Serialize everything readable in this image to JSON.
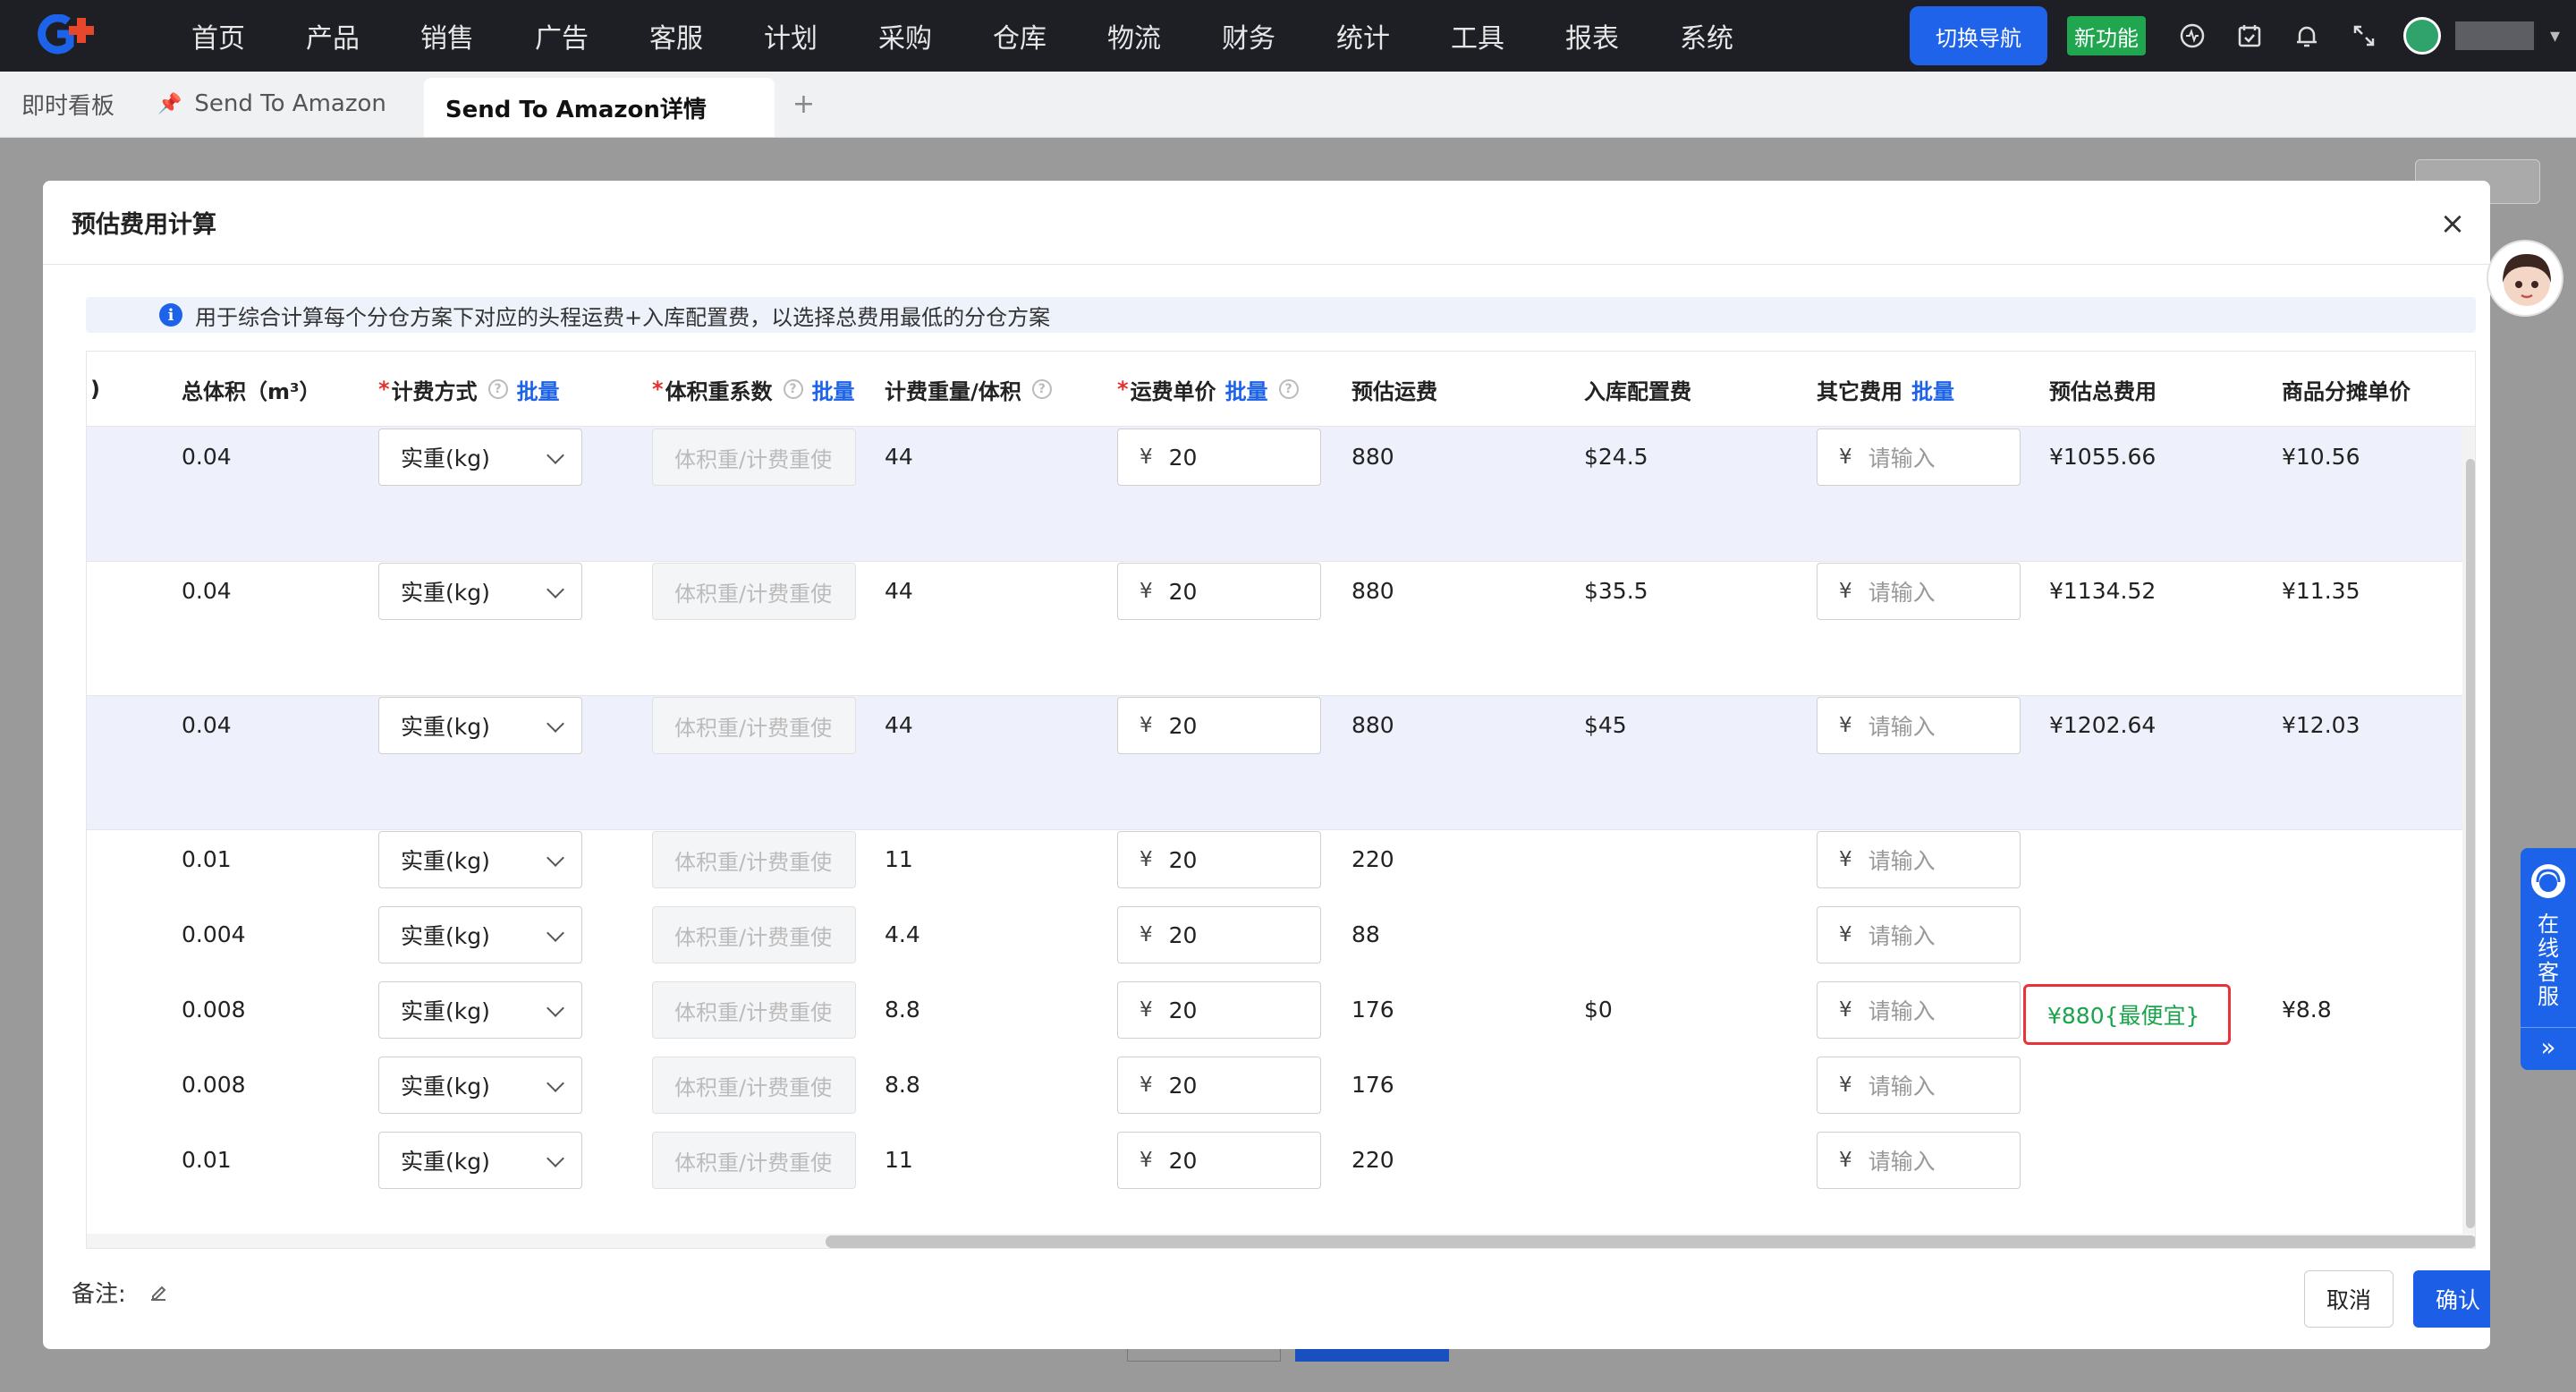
{
  "nav": {
    "items": [
      "首页",
      "产品",
      "销售",
      "广告",
      "客服",
      "计划",
      "采购",
      "仓库",
      "物流",
      "财务",
      "统计",
      "工具",
      "报表",
      "系统"
    ],
    "switch_nav": "切换导航",
    "new_feature": "新功能"
  },
  "tabs": {
    "items": [
      "即时看板",
      "Send To Amazon",
      "Send To Amazon详情"
    ],
    "plus": "+"
  },
  "modal": {
    "title": "预估费用计算",
    "close": "×",
    "info_text": "用于综合计算每个分仓方案下对应的头程运费+入库配置费，以选择总费用最低的分仓方案",
    "remark_label": "备注:",
    "cancel": "取消",
    "confirm": "确认"
  },
  "table": {
    "columns": {
      "paren": ")",
      "total_volume": "总体积（m³）",
      "billing_method": "计费方式",
      "volume_factor": "体积重系数",
      "billing_weight": "计费重量/体积",
      "freight_unit_price": "运费单价",
      "est_freight": "预估运费",
      "inbound_fee": "入库配置费",
      "other_fee": "其它费用",
      "est_total": "预估总费用",
      "unit_price": "商品分摊单价",
      "batch": "批量",
      "required": "*"
    },
    "select_value": "实重(kg)",
    "volume_placeholder": "体积重/计费重使",
    "yen": "¥",
    "other_placeholder": "请输入",
    "rows": [
      {
        "volume": "0.04",
        "weight": "44",
        "price": "20",
        "freight": "880",
        "inbound": "$24.5",
        "total": "¥1055.66",
        "unit": "¥10.56"
      },
      {
        "volume": "0.04",
        "weight": "44",
        "price": "20",
        "freight": "880",
        "inbound": "$35.5",
        "total": "¥1134.52",
        "unit": "¥11.35"
      },
      {
        "volume": "0.04",
        "weight": "44",
        "price": "20",
        "freight": "880",
        "inbound": "$45",
        "total": "¥1202.64",
        "unit": "¥12.03"
      }
    ],
    "group": {
      "rows": [
        {
          "volume": "0.01",
          "weight": "11",
          "price": "20",
          "freight": "220"
        },
        {
          "volume": "0.004",
          "weight": "4.4",
          "price": "20",
          "freight": "88"
        },
        {
          "volume": "0.008",
          "weight": "8.8",
          "price": "20",
          "freight": "176"
        },
        {
          "volume": "0.008",
          "weight": "8.8",
          "price": "20",
          "freight": "176"
        },
        {
          "volume": "0.01",
          "weight": "11",
          "price": "20",
          "freight": "220"
        }
      ],
      "inbound": "$0",
      "total": "¥880{最便宜}",
      "unit": "¥8.8"
    }
  },
  "customer_service": {
    "label": "在线客服",
    "collapse": "»"
  },
  "colors": {
    "accent": "#1d63e9",
    "highlight_row": "#eef1fb",
    "cheapest_border": "#e8333a",
    "cheapest_text": "#1aa34a"
  }
}
